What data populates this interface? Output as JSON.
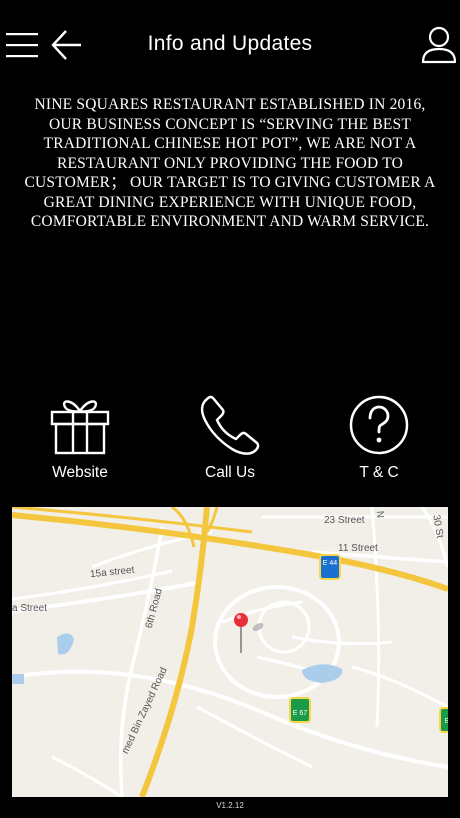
{
  "header": {
    "title": "Info and Updates",
    "menu_icon": "hamburger-menu-icon",
    "back_icon": "arrow-left-icon",
    "user_icon": "user-icon"
  },
  "description": "NINE SQUARES RESTAURANT ESTABLISHED IN 2016, OUR BUSINESS CONCEPT IS “SERVING THE BEST TRADITIONAL CHINESE HOT POT”, WE ARE NOT A RESTAURANT ONLY PROVIDING THE FOOD TO CUSTOMER；  OUR TARGET IS TO GIVING CUSTOMER A GREAT DINING EXPERIENCE WITH UNIQUE FOOD, COMFORTABLE ENVIRONMENT AND WARM SERVICE.",
  "actions": [
    {
      "label": "Website",
      "icon": "gift-icon"
    },
    {
      "label": "Call Us",
      "icon": "phone-icon"
    },
    {
      "label": "T & C",
      "icon": "question-circle-icon"
    }
  ],
  "map": {
    "streets": [
      "23 Street",
      "11 Street",
      "15a street",
      "6th Road",
      "a Street",
      "med Bin Zayed Road",
      "30 St",
      "N"
    ],
    "route_badges": [
      "E 44",
      "E 67",
      "E"
    ],
    "marker_icon": "map-pin-icon"
  },
  "version": "V1.2.12",
  "colors": {
    "background": "#000000",
    "text": "#ffffff",
    "map_land": "#f2efe9",
    "major_road": "#f4c63d",
    "water": "#a9cdea",
    "pin": "#e8303a"
  }
}
